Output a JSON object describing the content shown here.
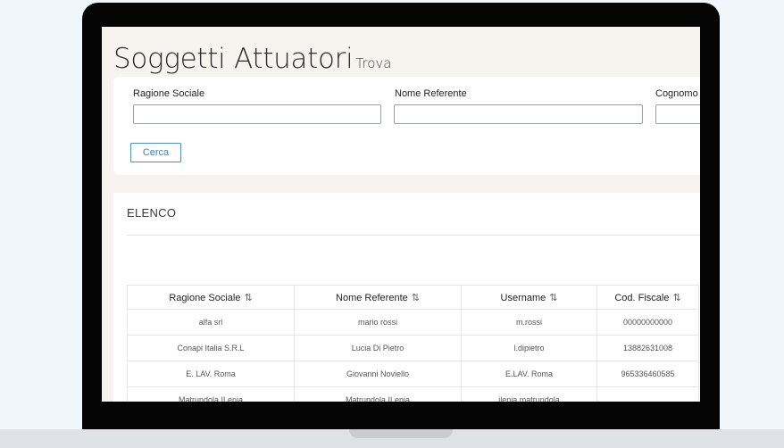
{
  "page": {
    "title": "Soggetti Attuatori",
    "subtitle": "Trova"
  },
  "search": {
    "fields": [
      {
        "label": "Ragione Sociale",
        "value": "",
        "placeholder": ""
      },
      {
        "label": "Nome Referente",
        "value": "",
        "placeholder": ""
      },
      {
        "label": "Cognomo",
        "value": "",
        "placeholder": ""
      }
    ],
    "button_label": "Cerca"
  },
  "list": {
    "title": "ELENCO",
    "sort_icon": "sort-arrows-icon",
    "sort_glyph": "⇅",
    "columns": [
      "Ragione Sociale",
      "Nome Referente",
      "Username",
      "Cod. Fiscale"
    ],
    "rows": [
      [
        "alfa srl",
        "mario rossi",
        "m.rossi",
        "00000000000"
      ],
      [
        "Conapi Italia S.R.L",
        "Lucia Di Pietro",
        "l.dipietro",
        "13882631008"
      ],
      [
        "E. LAV. Roma",
        "Giovanni Noviello",
        "E.LAV. Roma",
        "965336460585"
      ],
      [
        "Matrundola ILenja",
        "Matrundola ILenja",
        "ilenja.matrundola",
        ""
      ]
    ]
  },
  "colors": {
    "accent": "#3a7fc2",
    "screen_background": "#f7f3ee",
    "page_background": "#f1f6fb"
  }
}
